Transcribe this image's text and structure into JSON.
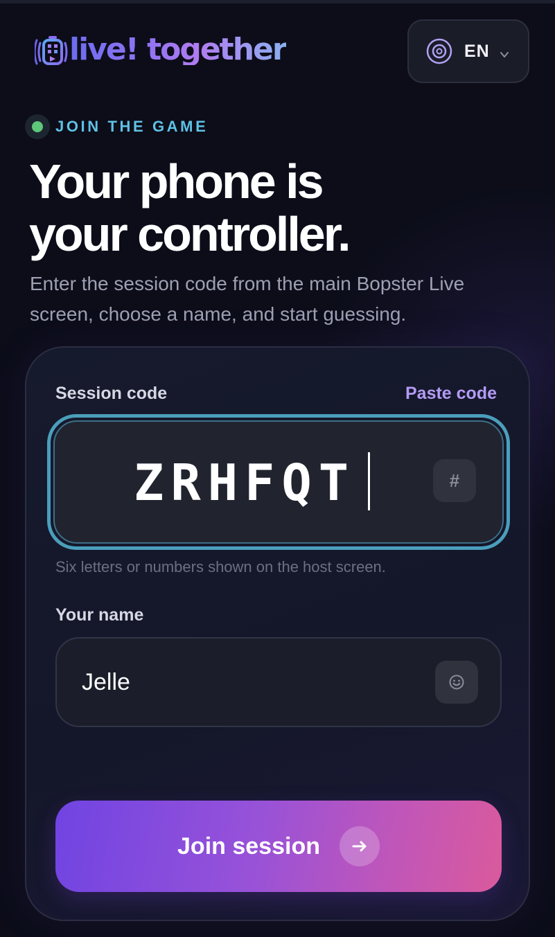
{
  "header": {
    "brand_name": "live! together",
    "language": {
      "selected": "EN"
    }
  },
  "hero": {
    "kicker": "JOIN THE GAME",
    "headline_line1": "Your phone is",
    "headline_line2": "your controller.",
    "subtitle": "Enter the session code from the main Bopster Live screen, choose a name, and start guessing."
  },
  "form": {
    "session_code": {
      "label": "Session code",
      "paste_label": "Paste code",
      "value": "ZRHFQT",
      "icon": "hash-icon",
      "icon_glyph": "#",
      "helper": "Six letters or numbers shown on the host screen."
    },
    "name": {
      "label": "Your name",
      "value": "Jelle",
      "icon": "smile-icon"
    },
    "submit": {
      "label": "Join session",
      "icon": "arrow-right-icon"
    }
  },
  "colors": {
    "background": "#0c0d19",
    "accent_cyan": "#5fc1e5",
    "accent_purple": "#b39bf3",
    "status_green": "#5ec77a",
    "button_gradient_start": "#7044e2",
    "button_gradient_end": "#da5a9c"
  }
}
